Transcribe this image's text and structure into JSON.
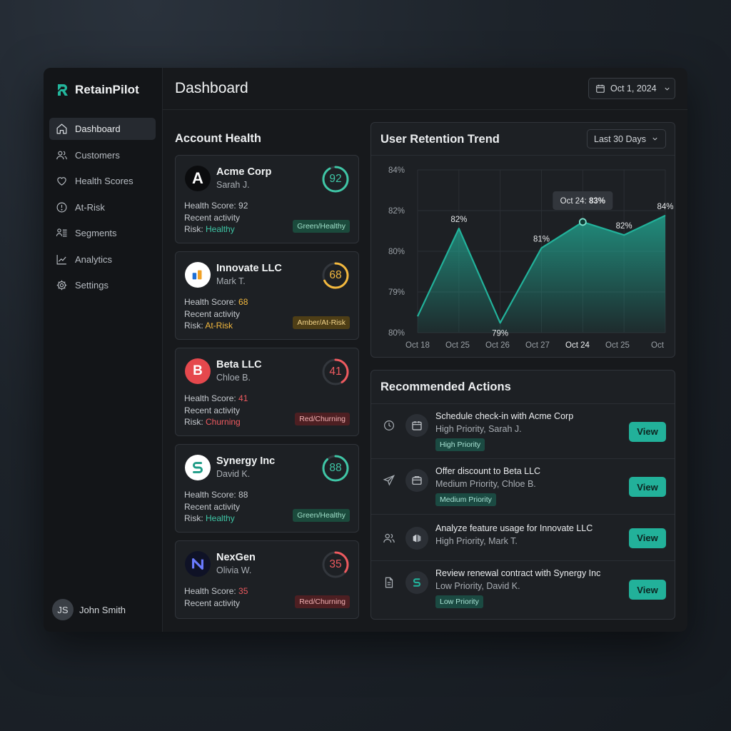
{
  "app": {
    "name": "RetainPilot"
  },
  "sidebar": {
    "items": [
      {
        "label": "Dashboard",
        "icon": "home-icon",
        "active": true
      },
      {
        "label": "Customers",
        "icon": "users-icon"
      },
      {
        "label": "Health Scores",
        "icon": "heart-icon"
      },
      {
        "label": "At-Risk",
        "icon": "alert-circle-icon"
      },
      {
        "label": "Segments",
        "icon": "segments-icon"
      },
      {
        "label": "Analytics",
        "icon": "line-chart-icon"
      },
      {
        "label": "Settings",
        "icon": "gear-icon"
      }
    ],
    "user": {
      "initials": "JS",
      "name": "John Smith"
    }
  },
  "header": {
    "title": "Dashboard",
    "date": "Oct 1, 2024"
  },
  "account_health": {
    "title": "Account Health",
    "accounts": [
      {
        "name": "Acme Corp",
        "owner": "Sarah J.",
        "score": 92,
        "score_label": "Health Score:",
        "score_text": "92",
        "activity": "Recent activity",
        "risk_label": "Risk:",
        "risk": "Healthy",
        "badge": "Green/Healthy",
        "status": "green",
        "logo": "A"
      },
      {
        "name": "Innovate LLC",
        "owner": "Mark T.",
        "score": 68,
        "score_label": "Health Score:",
        "score_text": "68",
        "activity": "Recent activity",
        "risk_label": "Risk:",
        "risk": "At-Risk",
        "badge": "Amber/At-Risk",
        "status": "amber",
        "logo": ""
      },
      {
        "name": "Beta LLC",
        "owner": "Chloe B.",
        "score": 41,
        "score_label": "Health Score:",
        "score_text": "41",
        "activity": "Recent activity",
        "risk_label": "Risk:",
        "risk": "Churning",
        "badge": "Red/Churning",
        "status": "red",
        "logo": "B"
      },
      {
        "name": "Synergy Inc",
        "owner": "David K.",
        "score": 88,
        "score_label": "Health Score:",
        "score_text": "88",
        "activity": "Recent activity",
        "risk_label": "Risk:",
        "risk": "Healthy",
        "badge": "Green/Healthy",
        "status": "green",
        "logo": "S"
      },
      {
        "name": "NexGen",
        "owner": "Olivia W.",
        "score": 35,
        "score_label": "Health Score:",
        "score_text": "35",
        "activity": "Recent activity",
        "risk_label": "",
        "risk": "",
        "badge": "Red/Churning",
        "status": "red",
        "logo": "N"
      }
    ]
  },
  "colors": {
    "green": "#22b19a",
    "amber": "#f0b429",
    "red": "#e5484d",
    "score_green": "#3fc6a6",
    "score_amber": "#f4b93e",
    "score_red": "#ee5a5f"
  },
  "retention": {
    "title": "User Retention Trend",
    "range": "Last 30 Days",
    "tooltip": {
      "date": "Oct 24:",
      "value": "83%"
    }
  },
  "chart_data": {
    "type": "area",
    "title": "User Retention Trend",
    "x": [
      "Oct 18",
      "Oct 25",
      "Oct 26",
      "Oct 27",
      "Oct 24",
      "Oct 25",
      "Oct"
    ],
    "y_tick_labels": [
      "84%",
      "82%",
      "80%",
      "79%",
      "80%"
    ],
    "series": [
      {
        "values": [
          79.5,
          82.2,
          79.3,
          81.6,
          82.4,
          82.0,
          82.6
        ]
      }
    ],
    "point_labels": [
      "",
      "82%",
      "79%",
      "81%",
      "",
      "82%",
      "84%"
    ],
    "highlight_index": 4,
    "grid": true,
    "color": "#22b19a"
  },
  "actions": {
    "title": "Recommended Actions",
    "button_label": "View",
    "items": [
      {
        "title": "Schedule check-in with Acme Corp",
        "sub": "High Priority, Sarah J.",
        "tag": "High Priority",
        "icon": "clock-icon",
        "circle_icon": "calendar-icon"
      },
      {
        "title": "Offer discount to Beta LLC",
        "sub": "Medium Priority, Chloe B.",
        "tag": "Medium Priority",
        "icon": "send-icon",
        "circle_icon": "discount-icon"
      },
      {
        "title": "Analyze feature usage for Innovate LLC",
        "sub": "High Priority, Mark T.",
        "tag": "",
        "icon": "users-icon",
        "circle_icon": "innovate-logo-icon"
      },
      {
        "title": "Review renewal contract with Synergy Inc",
        "sub": "Low Priority, David K.",
        "tag": "Low Priority",
        "icon": "document-icon",
        "circle_icon": "synergy-logo-icon"
      }
    ]
  }
}
